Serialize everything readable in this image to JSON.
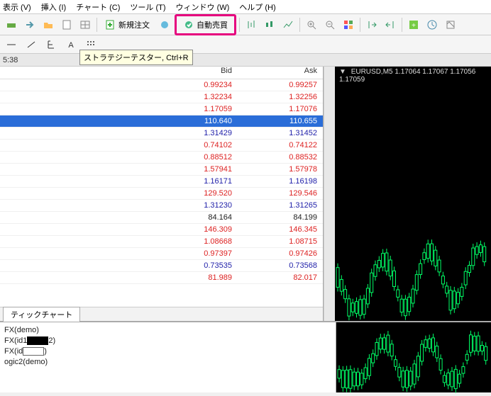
{
  "menu": {
    "view": "表示 (V)",
    "insert": "挿入 (I)",
    "chart": "チャート (C)",
    "tool": "ツール (T)",
    "window": "ウィンドウ (W)",
    "help": "ヘルプ (H)"
  },
  "toolbar": {
    "new_order": "新規注文",
    "auto_trade": "自動売買"
  },
  "tooltip": "ストラテジーテスター, Ctrl+R",
  "time_label": "5:38",
  "market": {
    "columns": {
      "bid": "Bid",
      "ask": "Ask"
    },
    "rows": [
      {
        "bid": "0.99234",
        "ask": "0.99257",
        "c": "red"
      },
      {
        "bid": "1.32234",
        "ask": "1.32256",
        "c": "red"
      },
      {
        "bid": "1.17059",
        "ask": "1.17076",
        "c": "red"
      },
      {
        "bid": "110.640",
        "ask": "110.655",
        "c": "sel"
      },
      {
        "bid": "1.31429",
        "ask": "1.31452",
        "c": "blue"
      },
      {
        "bid": "0.74102",
        "ask": "0.74122",
        "c": "red"
      },
      {
        "bid": "0.88512",
        "ask": "0.88532",
        "c": "red"
      },
      {
        "bid": "1.57941",
        "ask": "1.57978",
        "c": "red"
      },
      {
        "bid": "1.16171",
        "ask": "1.16198",
        "c": "blue"
      },
      {
        "bid": "129.520",
        "ask": "129.546",
        "c": "red"
      },
      {
        "bid": "1.31230",
        "ask": "1.31265",
        "c": "blue"
      },
      {
        "bid": "84.164",
        "ask": "84.199",
        "c": "black"
      },
      {
        "bid": "146.309",
        "ask": "146.345",
        "c": "red"
      },
      {
        "bid": "1.08668",
        "ask": "1.08715",
        "c": "red"
      },
      {
        "bid": "0.97397",
        "ask": "0.97426",
        "c": "red"
      },
      {
        "bid": "0.73535",
        "ask": "0.73568",
        "c": "blue"
      },
      {
        "bid": "81.989",
        "ask": "82.017",
        "c": "red"
      }
    ]
  },
  "tabs": {
    "tick": "ティックチャート"
  },
  "chart": {
    "title": "EURUSD,M5  1.17064  1.17067  1.17056  1.17059",
    "color_up": "#00ff66"
  },
  "accounts": {
    "l1": "FX(demo)",
    "l2a": "FX(id1",
    "l2b": "2)",
    "l3a": "FX(id",
    "l3b": ")",
    "l4": "ogic2(demo)"
  }
}
